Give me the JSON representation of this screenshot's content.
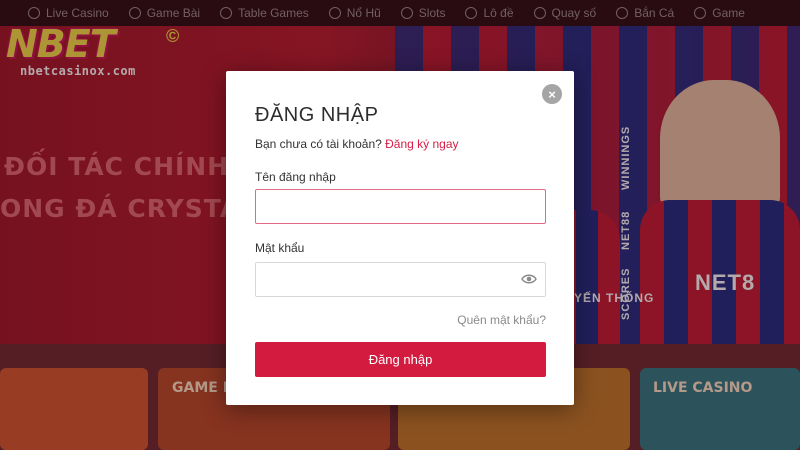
{
  "nav": {
    "items": [
      {
        "label": "Live Casino",
        "icon": "poker-chip-icon"
      },
      {
        "label": "Game Bài",
        "icon": "cards-icon"
      },
      {
        "label": "Table Games",
        "icon": "dice-icon"
      },
      {
        "label": "Nổ Hũ",
        "icon": "jackpot-icon"
      },
      {
        "label": "Slots",
        "icon": "cherry-icon"
      },
      {
        "label": "Lô đề",
        "icon": "lottery-ball-icon"
      },
      {
        "label": "Quay số",
        "icon": "wheel-icon"
      },
      {
        "label": "Bắn Cá",
        "icon": "fish-icon"
      },
      {
        "label": "Game",
        "icon": "gamepad-icon"
      }
    ]
  },
  "logo": {
    "text": "NBET",
    "mark": "©",
    "domain": "nbetcasinox.com"
  },
  "hero": {
    "line1": "ĐỐI TÁC CHÍNH THỨ",
    "line2": "ONG ĐÁ CRYSTAL PA",
    "side_labels": [
      "WINNINGS",
      "NET88",
      "SCORES",
      "YẾN THỐNG"
    ]
  },
  "cards": {
    "game_bai": "GAME B",
    "live_casino": "LIVE CASINO"
  },
  "modal": {
    "title": "ĐĂNG NHẬP",
    "no_account_text": "Bạn chưa có tài khoản?",
    "signup_link": "Đăng ký ngay",
    "username_label": "Tên đăng nhập",
    "username_value": "",
    "password_label": "Mật khẩu",
    "password_value": "",
    "forgot_link": "Quên mật khẩu?",
    "submit_label": "Đăng nhập",
    "close_glyph": "×"
  },
  "colors": {
    "accent": "#d31b3f",
    "link": "#d51d47",
    "logo_yellow": "#f4e04a"
  }
}
